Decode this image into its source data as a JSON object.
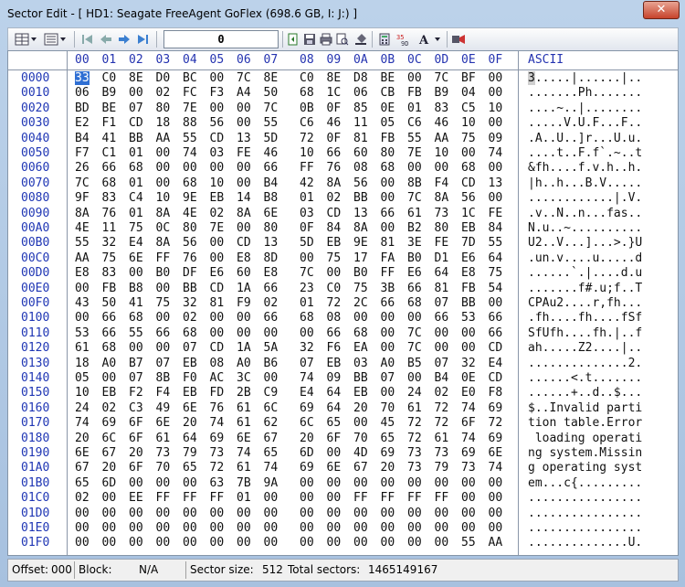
{
  "window": {
    "title": "Sector Edit - [ HD1: Seagate FreeAgent GoFlex (698.6 GB, I: J:) ]",
    "close_label": "✕"
  },
  "toolbar": {
    "offset_value": "0",
    "buttons": [
      "grid-view-icon",
      "list-view-icon",
      "first-sector-icon",
      "previous-sector-icon",
      "next-sector-icon",
      "last-sector-icon",
      "copy-icon",
      "save-icon",
      "print-icon",
      "print-preview-icon",
      "fill-icon",
      "calculator-icon",
      "hex-ascii-icon",
      "font-icon",
      "bookmark-icon"
    ]
  },
  "columns": [
    "00",
    "01",
    "02",
    "03",
    "04",
    "05",
    "06",
    "07",
    "08",
    "09",
    "0A",
    "0B",
    "0C",
    "0D",
    "0E",
    "0F"
  ],
  "ascii_header": "ASCII",
  "rows": [
    {
      "offset": "0000",
      "bytes": [
        "33",
        "C0",
        "8E",
        "D0",
        "BC",
        "00",
        "7C",
        "8E",
        "C0",
        "8E",
        "D8",
        "BE",
        "00",
        "7C",
        "BF",
        "00"
      ],
      "ascii": "3.....|......|.."
    },
    {
      "offset": "0010",
      "bytes": [
        "06",
        "B9",
        "00",
        "02",
        "FC",
        "F3",
        "A4",
        "50",
        "68",
        "1C",
        "06",
        "CB",
        "FB",
        "B9",
        "04",
        "00"
      ],
      "ascii": ".......Ph......."
    },
    {
      "offset": "0020",
      "bytes": [
        "BD",
        "BE",
        "07",
        "80",
        "7E",
        "00",
        "00",
        "7C",
        "0B",
        "0F",
        "85",
        "0E",
        "01",
        "83",
        "C5",
        "10"
      ],
      "ascii": "....~..|........"
    },
    {
      "offset": "0030",
      "bytes": [
        "E2",
        "F1",
        "CD",
        "18",
        "88",
        "56",
        "00",
        "55",
        "C6",
        "46",
        "11",
        "05",
        "C6",
        "46",
        "10",
        "00"
      ],
      "ascii": ".....V.U.F...F.."
    },
    {
      "offset": "0040",
      "bytes": [
        "B4",
        "41",
        "BB",
        "AA",
        "55",
        "CD",
        "13",
        "5D",
        "72",
        "0F",
        "81",
        "FB",
        "55",
        "AA",
        "75",
        "09"
      ],
      "ascii": ".A..U..]r...U.u."
    },
    {
      "offset": "0050",
      "bytes": [
        "F7",
        "C1",
        "01",
        "00",
        "74",
        "03",
        "FE",
        "46",
        "10",
        "66",
        "60",
        "80",
        "7E",
        "10",
        "00",
        "74"
      ],
      "ascii": "....t..F.f`.~..t"
    },
    {
      "offset": "0060",
      "bytes": [
        "26",
        "66",
        "68",
        "00",
        "00",
        "00",
        "00",
        "66",
        "FF",
        "76",
        "08",
        "68",
        "00",
        "00",
        "68",
        "00"
      ],
      "ascii": "&fh....f.v.h..h."
    },
    {
      "offset": "0070",
      "bytes": [
        "7C",
        "68",
        "01",
        "00",
        "68",
        "10",
        "00",
        "B4",
        "42",
        "8A",
        "56",
        "00",
        "8B",
        "F4",
        "CD",
        "13"
      ],
      "ascii": "|h..h...B.V....."
    },
    {
      "offset": "0080",
      "bytes": [
        "9F",
        "83",
        "C4",
        "10",
        "9E",
        "EB",
        "14",
        "B8",
        "01",
        "02",
        "BB",
        "00",
        "7C",
        "8A",
        "56",
        "00"
      ],
      "ascii": "............|.V."
    },
    {
      "offset": "0090",
      "bytes": [
        "8A",
        "76",
        "01",
        "8A",
        "4E",
        "02",
        "8A",
        "6E",
        "03",
        "CD",
        "13",
        "66",
        "61",
        "73",
        "1C",
        "FE"
      ],
      "ascii": ".v..N..n...fas.."
    },
    {
      "offset": "00A0",
      "bytes": [
        "4E",
        "11",
        "75",
        "0C",
        "80",
        "7E",
        "00",
        "80",
        "0F",
        "84",
        "8A",
        "00",
        "B2",
        "80",
        "EB",
        "84"
      ],
      "ascii": "N.u..~.........."
    },
    {
      "offset": "00B0",
      "bytes": [
        "55",
        "32",
        "E4",
        "8A",
        "56",
        "00",
        "CD",
        "13",
        "5D",
        "EB",
        "9E",
        "81",
        "3E",
        "FE",
        "7D",
        "55"
      ],
      "ascii": "U2..V...]...>.}U"
    },
    {
      "offset": "00C0",
      "bytes": [
        "AA",
        "75",
        "6E",
        "FF",
        "76",
        "00",
        "E8",
        "8D",
        "00",
        "75",
        "17",
        "FA",
        "B0",
        "D1",
        "E6",
        "64"
      ],
      "ascii": ".un.v....u.....d"
    },
    {
      "offset": "00D0",
      "bytes": [
        "E8",
        "83",
        "00",
        "B0",
        "DF",
        "E6",
        "60",
        "E8",
        "7C",
        "00",
        "B0",
        "FF",
        "E6",
        "64",
        "E8",
        "75"
      ],
      "ascii": "......`.|....d.u"
    },
    {
      "offset": "00E0",
      "bytes": [
        "00",
        "FB",
        "B8",
        "00",
        "BB",
        "CD",
        "1A",
        "66",
        "23",
        "C0",
        "75",
        "3B",
        "66",
        "81",
        "FB",
        "54"
      ],
      "ascii": ".......f#.u;f..T"
    },
    {
      "offset": "00F0",
      "bytes": [
        "43",
        "50",
        "41",
        "75",
        "32",
        "81",
        "F9",
        "02",
        "01",
        "72",
        "2C",
        "66",
        "68",
        "07",
        "BB",
        "00"
      ],
      "ascii": "CPAu2....r,fh..."
    },
    {
      "offset": "0100",
      "bytes": [
        "00",
        "66",
        "68",
        "00",
        "02",
        "00",
        "00",
        "66",
        "68",
        "08",
        "00",
        "00",
        "00",
        "66",
        "53",
        "66"
      ],
      "ascii": ".fh....fh....fSf"
    },
    {
      "offset": "0110",
      "bytes": [
        "53",
        "66",
        "55",
        "66",
        "68",
        "00",
        "00",
        "00",
        "00",
        "66",
        "68",
        "00",
        "7C",
        "00",
        "00",
        "66"
      ],
      "ascii": "SfUfh....fh.|..f"
    },
    {
      "offset": "0120",
      "bytes": [
        "61",
        "68",
        "00",
        "00",
        "07",
        "CD",
        "1A",
        "5A",
        "32",
        "F6",
        "EA",
        "00",
        "7C",
        "00",
        "00",
        "CD"
      ],
      "ascii": "ah.....Z2....|.."
    },
    {
      "offset": "0130",
      "bytes": [
        "18",
        "A0",
        "B7",
        "07",
        "EB",
        "08",
        "A0",
        "B6",
        "07",
        "EB",
        "03",
        "A0",
        "B5",
        "07",
        "32",
        "E4"
      ],
      "ascii": "..............2."
    },
    {
      "offset": "0140",
      "bytes": [
        "05",
        "00",
        "07",
        "8B",
        "F0",
        "AC",
        "3C",
        "00",
        "74",
        "09",
        "BB",
        "07",
        "00",
        "B4",
        "0E",
        "CD"
      ],
      "ascii": "......<.t......."
    },
    {
      "offset": "0150",
      "bytes": [
        "10",
        "EB",
        "F2",
        "F4",
        "EB",
        "FD",
        "2B",
        "C9",
        "E4",
        "64",
        "EB",
        "00",
        "24",
        "02",
        "E0",
        "F8"
      ],
      "ascii": "......+..d..$..."
    },
    {
      "offset": "0160",
      "bytes": [
        "24",
        "02",
        "C3",
        "49",
        "6E",
        "76",
        "61",
        "6C",
        "69",
        "64",
        "20",
        "70",
        "61",
        "72",
        "74",
        "69"
      ],
      "ascii": "$..Invalid parti"
    },
    {
      "offset": "0170",
      "bytes": [
        "74",
        "69",
        "6F",
        "6E",
        "20",
        "74",
        "61",
        "62",
        "6C",
        "65",
        "00",
        "45",
        "72",
        "72",
        "6F",
        "72"
      ],
      "ascii": "tion table.Error"
    },
    {
      "offset": "0180",
      "bytes": [
        "20",
        "6C",
        "6F",
        "61",
        "64",
        "69",
        "6E",
        "67",
        "20",
        "6F",
        "70",
        "65",
        "72",
        "61",
        "74",
        "69"
      ],
      "ascii": " loading operati"
    },
    {
      "offset": "0190",
      "bytes": [
        "6E",
        "67",
        "20",
        "73",
        "79",
        "73",
        "74",
        "65",
        "6D",
        "00",
        "4D",
        "69",
        "73",
        "73",
        "69",
        "6E"
      ],
      "ascii": "ng system.Missin"
    },
    {
      "offset": "01A0",
      "bytes": [
        "67",
        "20",
        "6F",
        "70",
        "65",
        "72",
        "61",
        "74",
        "69",
        "6E",
        "67",
        "20",
        "73",
        "79",
        "73",
        "74"
      ],
      "ascii": "g operating syst"
    },
    {
      "offset": "01B0",
      "bytes": [
        "65",
        "6D",
        "00",
        "00",
        "00",
        "63",
        "7B",
        "9A",
        "00",
        "00",
        "00",
        "00",
        "00",
        "00",
        "00",
        "00"
      ],
      "ascii": "em...c{........."
    },
    {
      "offset": "01C0",
      "bytes": [
        "02",
        "00",
        "EE",
        "FF",
        "FF",
        "FF",
        "01",
        "00",
        "00",
        "00",
        "FF",
        "FF",
        "FF",
        "FF",
        "00",
        "00"
      ],
      "ascii": "................"
    },
    {
      "offset": "01D0",
      "bytes": [
        "00",
        "00",
        "00",
        "00",
        "00",
        "00",
        "00",
        "00",
        "00",
        "00",
        "00",
        "00",
        "00",
        "00",
        "00",
        "00"
      ],
      "ascii": "................"
    },
    {
      "offset": "01E0",
      "bytes": [
        "00",
        "00",
        "00",
        "00",
        "00",
        "00",
        "00",
        "00",
        "00",
        "00",
        "00",
        "00",
        "00",
        "00",
        "00",
        "00"
      ],
      "ascii": "................"
    },
    {
      "offset": "01F0",
      "bytes": [
        "00",
        "00",
        "00",
        "00",
        "00",
        "00",
        "00",
        "00",
        "00",
        "00",
        "00",
        "00",
        "00",
        "00",
        "55",
        "AA"
      ],
      "ascii": "..............U."
    }
  ],
  "status": {
    "offset_label": "Offset:",
    "offset_value": "000",
    "block_label": "Block:",
    "block_value": "N/A",
    "sector_size_label": "Sector size:",
    "sector_size_value": "512",
    "total_sectors_label": "Total sectors:",
    "total_sectors_value": "1465149167"
  },
  "colors": {
    "offset_blue": "#1f36b4",
    "selection_blue": "#2f6fd3",
    "close_red": "#c7432b"
  }
}
